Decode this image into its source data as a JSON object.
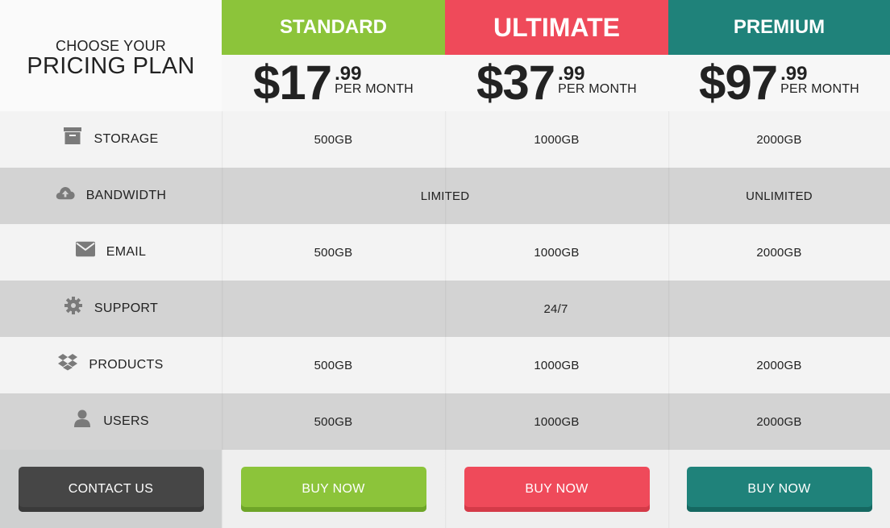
{
  "header": {
    "heading_small": "CHOOSE YOUR",
    "heading_big": "PRICING PLAN"
  },
  "plans": [
    {
      "name": "STANDARD",
      "dollars": "$17",
      "cents": ".99",
      "period": "PER MONTH",
      "color": "#8cc43a",
      "button": "BUY NOW",
      "button_color": "#8cc43a",
      "button_shadow": "#6ea528"
    },
    {
      "name": "ULTIMATE",
      "dollars": "$37",
      "cents": ".99",
      "period": "PER MONTH",
      "color": "#ef4a5a",
      "button": "BUY NOW",
      "button_color": "#ef4a5a",
      "button_shadow": "#d43a48"
    },
    {
      "name": "PREMIUM",
      "dollars": "$97",
      "cents": ".99",
      "period": "PER MONTH",
      "color": "#1f827a",
      "button": "BUY NOW",
      "button_color": "#1f827a",
      "button_shadow": "#156861"
    }
  ],
  "features": [
    {
      "label": "STORAGE",
      "icon": "archive-icon",
      "values": [
        "500GB",
        "1000GB",
        "2000GB"
      ]
    },
    {
      "label": "BANDWIDTH",
      "icon": "cloud-upload-icon",
      "values": [
        "LIMITED",
        "UNLIMITED"
      ]
    },
    {
      "label": "EMAIL",
      "icon": "envelope-icon",
      "values": [
        "500GB",
        "1000GB",
        "2000GB"
      ]
    },
    {
      "label": "SUPPORT",
      "icon": "gear-icon",
      "values": [
        "24/7"
      ]
    },
    {
      "label": "PRODUCTS",
      "icon": "dropbox-icon",
      "values": [
        "500GB",
        "1000GB",
        "2000GB"
      ]
    },
    {
      "label": "USERS",
      "icon": "user-icon",
      "values": [
        "500GB",
        "1000GB",
        "2000GB"
      ]
    }
  ],
  "contact": {
    "label": "CONTACT US",
    "color": "#464646"
  }
}
